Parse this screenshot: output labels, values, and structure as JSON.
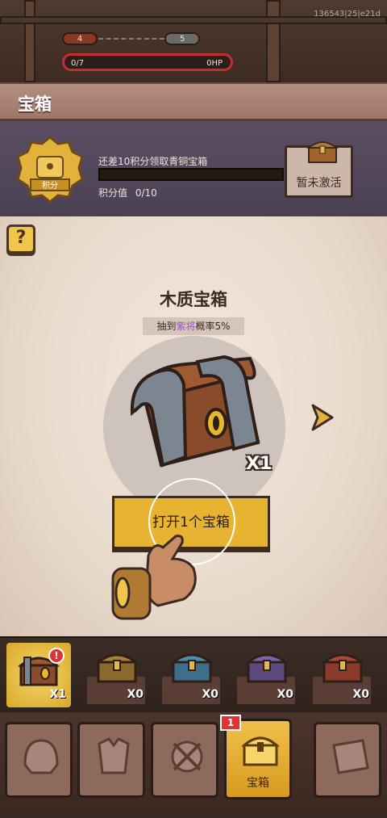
{
  "hud": {
    "build_id": "136543|25|e21d",
    "level_current": "4",
    "level_next": "5",
    "hp_left": "0/7",
    "hp_right": "0HP"
  },
  "page": {
    "title": "宝箱"
  },
  "progress": {
    "hint": "还差10积分领取青铜宝箱",
    "score_label": "积分值",
    "score_value": "0/10",
    "fill_fraction": 0.0,
    "medal_text": "积分",
    "inactive_label": "暂未激活"
  },
  "main": {
    "help_label": "?",
    "chest_name": "木质宝箱",
    "rate_prefix": "抽到",
    "rate_highlight": "紫将",
    "rate_suffix": "概率5%",
    "count": "X1",
    "open_button": "打开1个宝箱"
  },
  "chest_slots": [
    {
      "count": "X1",
      "selected": true,
      "badge": "!"
    },
    {
      "count": "X0",
      "selected": false
    },
    {
      "count": "X0",
      "selected": false
    },
    {
      "count": "X0",
      "selected": false
    },
    {
      "count": "X0",
      "selected": false
    }
  ],
  "nav": {
    "chest_label": "宝箱",
    "chest_notif": "1"
  },
  "colors": {
    "accent_gold": "#e7b431",
    "hp_red": "#c62e2e",
    "purple_rarity": "#9b4bd8"
  }
}
